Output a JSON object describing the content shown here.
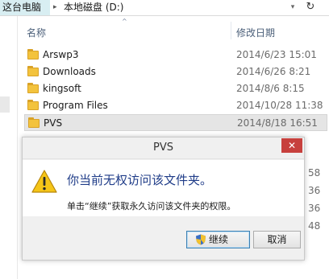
{
  "address_bar": {
    "root": "这台电脑",
    "separator": "▸",
    "drive": "本地磁盘 (D:)",
    "dropdown_icon": "chevron-down-icon",
    "refresh_icon": "refresh-icon",
    "root_highlight": "#d8eef2"
  },
  "columns": {
    "name": "名称",
    "modified": "修改日期"
  },
  "rows": [
    {
      "name": "Arswp3",
      "date": "2014/6/23 15:01",
      "selected": false
    },
    {
      "name": "Downloads",
      "date": "2014/6/26 8:21",
      "selected": false
    },
    {
      "name": "kingsoft",
      "date": "2014/8/6 8:15",
      "selected": false
    },
    {
      "name": "Program Files",
      "date": "2014/10/28 11:38",
      "selected": false
    },
    {
      "name": "PVS",
      "date": "2014/8/18 16:51",
      "selected": true
    }
  ],
  "peek": [
    "58",
    "36",
    "36",
    "48"
  ],
  "dialog": {
    "title": "PVS",
    "close": "✕",
    "heading": "你当前无权访问该文件夹。",
    "message": "单击“继续”获取永久访问该文件夹的权限。",
    "continue_label": "继续",
    "cancel_label": "取消",
    "close_color": "#c7403d",
    "heading_color": "#1f3c88"
  }
}
